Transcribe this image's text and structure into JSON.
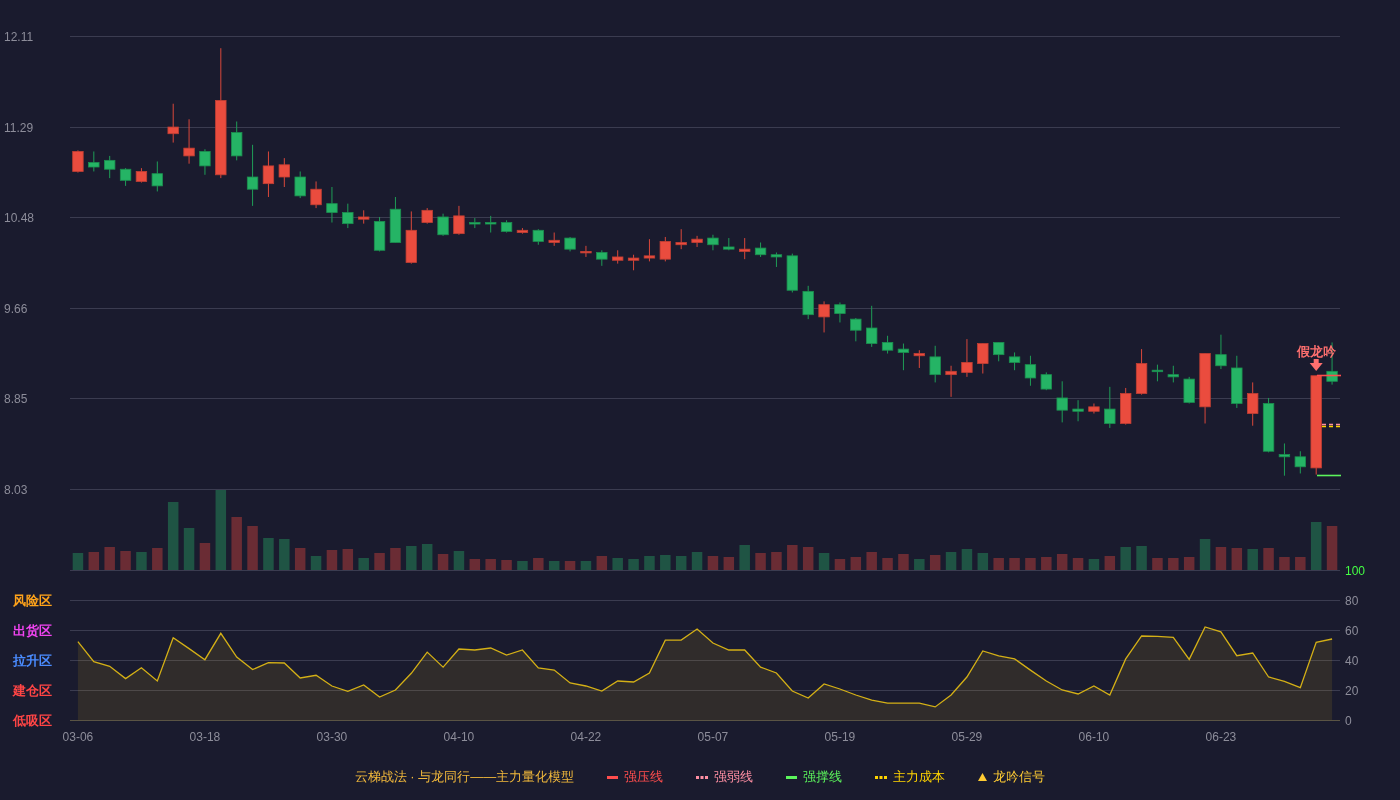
{
  "price_chart": {
    "chart_data": {
      "type": "candlestick",
      "categories": [
        null,
        null,
        null,
        null,
        null,
        null,
        null,
        null,
        null,
        null,
        null,
        null,
        null,
        null,
        null,
        null,
        null,
        null,
        null,
        null,
        null,
        null,
        null,
        null,
        null,
        null,
        null,
        null,
        null,
        null,
        null,
        null,
        null,
        null,
        null,
        null,
        null,
        null,
        null,
        null,
        null,
        null,
        null,
        null,
        null,
        null,
        null,
        null,
        null,
        null,
        null,
        null,
        null,
        null,
        null,
        null,
        null,
        null,
        null,
        null,
        null,
        null,
        null,
        null,
        null,
        null,
        null,
        null,
        null,
        null,
        null,
        null,
        null,
        null,
        null,
        null,
        null,
        null,
        null,
        null
      ],
      "ohlc": [
        [
          10.89,
          11.08,
          10.88,
          11.07
        ],
        [
          10.97,
          11.07,
          10.89,
          10.93
        ],
        [
          10.99,
          11.03,
          10.83,
          10.91
        ],
        [
          10.91,
          10.92,
          10.76,
          10.81
        ],
        [
          10.8,
          10.92,
          10.79,
          10.89
        ],
        [
          10.87,
          10.98,
          10.71,
          10.76
        ],
        [
          11.23,
          11.5,
          11.15,
          11.29
        ],
        [
          11.03,
          11.36,
          10.96,
          11.1
        ],
        [
          11.07,
          11.09,
          10.86,
          10.94
        ],
        [
          10.86,
          12.0,
          10.83,
          11.53
        ],
        [
          11.24,
          11.34,
          10.99,
          11.03
        ],
        [
          10.84,
          11.13,
          10.58,
          10.73
        ],
        [
          10.78,
          11.07,
          10.66,
          10.94
        ],
        [
          10.84,
          11.01,
          10.75,
          10.95
        ],
        [
          10.84,
          10.89,
          10.65,
          10.67
        ],
        [
          10.59,
          10.8,
          10.56,
          10.73
        ],
        [
          10.6,
          10.75,
          10.43,
          10.52
        ],
        [
          10.52,
          10.6,
          10.38,
          10.42
        ],
        [
          10.46,
          10.54,
          10.42,
          10.48
        ],
        [
          10.44,
          10.48,
          10.17,
          10.18
        ],
        [
          10.55,
          10.66,
          10.25,
          10.25
        ],
        [
          10.07,
          10.53,
          10.06,
          10.36
        ],
        [
          10.43,
          10.56,
          10.42,
          10.54
        ],
        [
          10.48,
          10.51,
          10.31,
          10.32
        ],
        [
          10.33,
          10.58,
          10.32,
          10.49
        ],
        [
          10.43,
          10.47,
          10.38,
          10.42
        ],
        [
          10.43,
          10.49,
          10.34,
          10.42
        ],
        [
          10.43,
          10.45,
          10.34,
          10.35
        ],
        [
          10.34,
          10.38,
          10.33,
          10.36
        ],
        [
          10.36,
          10.37,
          10.23,
          10.26
        ],
        [
          10.25,
          10.34,
          10.22,
          10.27
        ],
        [
          10.29,
          10.3,
          10.17,
          10.19
        ],
        [
          10.16,
          10.22,
          10.12,
          10.17
        ],
        [
          10.16,
          10.18,
          10.04,
          10.1
        ],
        [
          10.09,
          10.18,
          10.06,
          10.12
        ],
        [
          10.09,
          10.14,
          10.0,
          10.11
        ],
        [
          10.11,
          10.28,
          10.08,
          10.13
        ],
        [
          10.1,
          10.3,
          10.08,
          10.26
        ],
        [
          10.23,
          10.37,
          10.19,
          10.25
        ],
        [
          10.25,
          10.31,
          10.21,
          10.28
        ],
        [
          10.29,
          10.32,
          10.18,
          10.23
        ],
        [
          10.21,
          10.29,
          10.18,
          10.19
        ],
        [
          10.17,
          10.29,
          10.1,
          10.19
        ],
        [
          10.2,
          10.25,
          10.12,
          10.14
        ],
        [
          10.14,
          10.16,
          10.03,
          10.12
        ],
        [
          10.13,
          10.15,
          9.8,
          9.82
        ],
        [
          9.81,
          9.86,
          9.56,
          9.6
        ],
        [
          9.58,
          9.72,
          9.44,
          9.69
        ],
        [
          9.69,
          9.71,
          9.53,
          9.61
        ],
        [
          9.56,
          9.57,
          9.36,
          9.46
        ],
        [
          9.48,
          9.68,
          9.31,
          9.34
        ],
        [
          9.35,
          9.41,
          9.25,
          9.28
        ],
        [
          9.29,
          9.34,
          9.1,
          9.26
        ],
        [
          9.23,
          9.28,
          9.12,
          9.25
        ],
        [
          9.22,
          9.32,
          8.99,
          9.06
        ],
        [
          9.06,
          9.14,
          8.86,
          9.09
        ],
        [
          9.08,
          9.38,
          9.04,
          9.17
        ],
        [
          9.16,
          9.34,
          9.07,
          9.34
        ],
        [
          9.35,
          9.35,
          9.18,
          9.24
        ],
        [
          9.22,
          9.26,
          9.1,
          9.17
        ],
        [
          9.15,
          9.23,
          8.96,
          9.03
        ],
        [
          9.06,
          9.08,
          8.92,
          8.93
        ],
        [
          8.85,
          9.0,
          8.63,
          8.74
        ],
        [
          8.75,
          8.83,
          8.64,
          8.73
        ],
        [
          8.73,
          8.8,
          8.71,
          8.77
        ],
        [
          8.75,
          8.95,
          8.58,
          8.62
        ],
        [
          8.62,
          8.94,
          8.61,
          8.89
        ],
        [
          8.89,
          9.29,
          8.88,
          9.16
        ],
        [
          9.1,
          9.15,
          9.0,
          9.09
        ],
        [
          9.06,
          9.14,
          8.99,
          9.04
        ],
        [
          9.02,
          9.04,
          8.8,
          8.81
        ],
        [
          8.77,
          9.25,
          8.62,
          9.25
        ],
        [
          9.24,
          9.42,
          9.11,
          9.14
        ],
        [
          9.12,
          9.23,
          8.76,
          8.8
        ],
        [
          8.71,
          8.99,
          8.6,
          8.89
        ],
        [
          8.8,
          8.85,
          8.36,
          8.37
        ],
        [
          8.34,
          8.44,
          8.15,
          8.32
        ],
        [
          8.32,
          8.37,
          8.17,
          8.23
        ],
        [
          8.22,
          9.05,
          8.16,
          9.05
        ],
        [
          9.09,
          9.35,
          8.97,
          9.0
        ]
      ],
      "ylim": [
        8.03,
        12.11
      ],
      "yticks": [
        12.11,
        11.29,
        10.48,
        9.66,
        8.85,
        8.03
      ],
      "grid": true
    },
    "signal": {
      "label": "假龙吟"
    }
  },
  "indicator": {
    "zones": [
      {
        "label": "风险区",
        "color": "#ffa31a"
      },
      {
        "label": "出货区",
        "color": "#f044f0"
      },
      {
        "label": "拉升区",
        "color": "#4a8cff"
      },
      {
        "label": "建仓区",
        "color": "#ff4545"
      },
      {
        "label": "低吸区",
        "color": "#ff4545"
      }
    ],
    "chart_data": {
      "type": "area",
      "categories": [
        "03-06",
        null,
        null,
        null,
        null,
        null,
        null,
        null,
        "03-18",
        null,
        null,
        null,
        null,
        null,
        null,
        null,
        "03-30",
        null,
        null,
        null,
        null,
        null,
        null,
        null,
        "04-10",
        null,
        null,
        null,
        null,
        null,
        null,
        null,
        "04-22",
        null,
        null,
        null,
        null,
        null,
        null,
        null,
        "05-07",
        null,
        null,
        null,
        null,
        null,
        null,
        null,
        "05-19",
        null,
        null,
        null,
        null,
        null,
        null,
        null,
        "05-29",
        null,
        null,
        null,
        null,
        null,
        null,
        null,
        "06-10",
        null,
        null,
        null,
        null,
        null,
        null,
        null,
        "06-23",
        null,
        null,
        null,
        null,
        null,
        null,
        null
      ],
      "series": [
        {
          "color": "#d4b016",
          "values": [
            52.2,
            38.9,
            35.8,
            27.6,
            34.9,
            26,
            54.9,
            47.6,
            40.2,
            57.8,
            42,
            33.6,
            38.2,
            38,
            28,
            29.8,
            22.7,
            19.1,
            23.3,
            15.3,
            20,
            31.1,
            45.3,
            35.3,
            47.3,
            46.7,
            48,
            43.3,
            46.7,
            34.7,
            33.3,
            24.7,
            22.7,
            19.3,
            26,
            25.3,
            31.3,
            53.3,
            53.3,
            60.7,
            51.3,
            46.7,
            46.7,
            35.3,
            31.3,
            19.3,
            14.7,
            24,
            20.7,
            16.7,
            13.3,
            11.3,
            11.3,
            11.3,
            8.7,
            16.7,
            28.7,
            46,
            42.7,
            40.7,
            33.3,
            26,
            20,
            17.3,
            22.7,
            16.7,
            40.7,
            56,
            55.7,
            55.1,
            40.4,
            62,
            58.7,
            42.9,
            44.7,
            28.7,
            25.8,
            21.6,
            51.8,
            54
          ]
        }
      ],
      "ylim": [
        0,
        100
      ],
      "yticks": [
        100,
        80,
        60,
        40,
        20,
        0
      ],
      "grid": true
    }
  },
  "legend": {
    "title": "云梯战法 · 与龙同行——主力量化模型",
    "items": [
      {
        "label": "强压线",
        "kind": "solid",
        "color": "#ff4d4d"
      },
      {
        "label": "强弱线",
        "kind": "dashed",
        "color": "#ff8fa3"
      },
      {
        "label": "强撑线",
        "kind": "solid",
        "color": "#5cf55c"
      },
      {
        "label": "主力成本",
        "kind": "dashed",
        "color": "#ffd400"
      },
      {
        "label": "龙吟信号",
        "kind": "triangle",
        "color": "#ffcc33"
      }
    ]
  }
}
